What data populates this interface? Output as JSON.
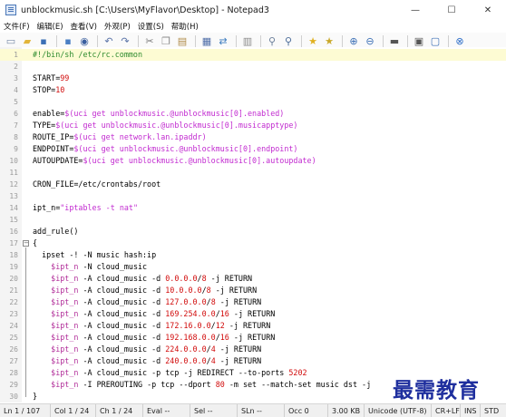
{
  "window": {
    "title": "unblockmusic.sh [C:\\Users\\MyFlavor\\Desktop] - Notepad3",
    "controls": {
      "minimize": "—",
      "maximize": "☐",
      "close": "✕"
    }
  },
  "menu": [
    "文件(F)",
    "编辑(E)",
    "查看(V)",
    "外观(P)",
    "设置(S)",
    "帮助(H)"
  ],
  "toolbar": [
    {
      "name": "new-file-icon",
      "glyph": "▭",
      "color": "#7a8ca8"
    },
    {
      "name": "open-folder-icon",
      "glyph": "▰",
      "color": "#e2b53a"
    },
    {
      "name": "save-icon",
      "glyph": "▪",
      "color": "#3b6fb5"
    },
    {
      "name": "sep"
    },
    {
      "name": "save-as-icon",
      "glyph": "▪",
      "color": "#4a7fc4"
    },
    {
      "name": "browse-icon",
      "glyph": "◉",
      "color": "#3a5f9e"
    },
    {
      "name": "sep"
    },
    {
      "name": "undo-icon",
      "glyph": "↶",
      "color": "#5a73a8"
    },
    {
      "name": "redo-icon",
      "glyph": "↷",
      "color": "#5a73a8"
    },
    {
      "name": "sep"
    },
    {
      "name": "cut-icon",
      "glyph": "✂",
      "color": "#7a7a7a"
    },
    {
      "name": "copy-icon",
      "glyph": "❐",
      "color": "#8a8a8a"
    },
    {
      "name": "paste-icon",
      "glyph": "▤",
      "color": "#b08c4a"
    },
    {
      "name": "sep"
    },
    {
      "name": "find-icon",
      "glyph": "▦",
      "color": "#4f6ea8"
    },
    {
      "name": "replace-icon",
      "glyph": "⇄",
      "color": "#3b7bbf"
    },
    {
      "name": "sep"
    },
    {
      "name": "word-wrap-icon",
      "glyph": "▥",
      "color": "#8a8a8a"
    },
    {
      "name": "sep"
    },
    {
      "name": "zoom-in-icon",
      "glyph": "⚲",
      "color": "#6b7f9a"
    },
    {
      "name": "zoom-search-icon",
      "glyph": "⚲",
      "color": "#4d6d9a"
    },
    {
      "name": "sep"
    },
    {
      "name": "favorite-icon",
      "glyph": "★",
      "color": "#e0b020"
    },
    {
      "name": "add-favorite-icon",
      "glyph": "★",
      "color": "#c9a82a"
    },
    {
      "name": "sep"
    },
    {
      "name": "zoom-in-lens-icon",
      "glyph": "⊕",
      "color": "#3b6fb5"
    },
    {
      "name": "zoom-out-lens-icon",
      "glyph": "⊖",
      "color": "#3b6fb5"
    },
    {
      "name": "sep"
    },
    {
      "name": "scheme-icon",
      "glyph": "▬",
      "color": "#555"
    },
    {
      "name": "sep"
    },
    {
      "name": "customize-icon",
      "glyph": "▣",
      "color": "#555"
    },
    {
      "name": "window-icon",
      "glyph": "▢",
      "color": "#3b6fb5"
    },
    {
      "name": "sep"
    },
    {
      "name": "exit-icon",
      "glyph": "⊗",
      "color": "#2f6fc8"
    }
  ],
  "editor": {
    "current_line": 1,
    "lines": [
      [
        [
          "#!/bin/sh /etc/rc.common",
          "cmt"
        ]
      ],
      [],
      [
        [
          "START=",
          "dflt"
        ],
        [
          "99",
          "num"
        ]
      ],
      [
        [
          "STOP=",
          "dflt"
        ],
        [
          "10",
          "num"
        ]
      ],
      [],
      [
        [
          "enable=",
          "dflt"
        ],
        [
          "$(uci get unblockmusic.@unblockmusic[0].enabled)",
          "str"
        ]
      ],
      [
        [
          "TYPE=",
          "dflt"
        ],
        [
          "$(uci get unblockmusic.@unblockmusic[0].musicapptype)",
          "str"
        ]
      ],
      [
        [
          "ROUTE_IP=",
          "dflt"
        ],
        [
          "$(uci get network.lan.ipaddr)",
          "str"
        ]
      ],
      [
        [
          "ENDPOINT=",
          "dflt"
        ],
        [
          "$(uci get unblockmusic.@unblockmusic[0].endpoint)",
          "str"
        ]
      ],
      [
        [
          "AUTOUPDATE=",
          "dflt"
        ],
        [
          "$(uci get unblockmusic.@unblockmusic[0].autoupdate)",
          "str"
        ]
      ],
      [],
      [
        [
          "CRON_FILE=/etc/crontabs/root",
          "dflt"
        ]
      ],
      [],
      [
        [
          "ipt_n=",
          "dflt"
        ],
        [
          "\"iptables -t nat\"",
          "str"
        ]
      ],
      [],
      [
        [
          "add_rule()",
          "dflt"
        ]
      ],
      [
        [
          "{",
          "dflt"
        ]
      ],
      [
        [
          "  ipset -! -N music hash:ip",
          "dflt"
        ]
      ],
      [
        [
          "    ",
          "dflt"
        ],
        [
          "$ipt_n",
          "var"
        ],
        [
          " -N cloud_music",
          "dflt"
        ]
      ],
      [
        [
          "    ",
          "dflt"
        ],
        [
          "$ipt_n",
          "var"
        ],
        [
          " -A cloud_music -d ",
          "dflt"
        ],
        [
          "0.0.0.0",
          "num"
        ],
        [
          "/",
          "dflt"
        ],
        [
          "8",
          "num"
        ],
        [
          " -j RETURN",
          "dflt"
        ]
      ],
      [
        [
          "    ",
          "dflt"
        ],
        [
          "$ipt_n",
          "var"
        ],
        [
          " -A cloud_music -d ",
          "dflt"
        ],
        [
          "10.0.0.0",
          "num"
        ],
        [
          "/",
          "dflt"
        ],
        [
          "8",
          "num"
        ],
        [
          " -j RETURN",
          "dflt"
        ]
      ],
      [
        [
          "    ",
          "dflt"
        ],
        [
          "$ipt_n",
          "var"
        ],
        [
          " -A cloud_music -d ",
          "dflt"
        ],
        [
          "127.0.0.0",
          "num"
        ],
        [
          "/",
          "dflt"
        ],
        [
          "8",
          "num"
        ],
        [
          " -j RETURN",
          "dflt"
        ]
      ],
      [
        [
          "    ",
          "dflt"
        ],
        [
          "$ipt_n",
          "var"
        ],
        [
          " -A cloud_music -d ",
          "dflt"
        ],
        [
          "169.254.0.0",
          "num"
        ],
        [
          "/",
          "dflt"
        ],
        [
          "16",
          "num"
        ],
        [
          " -j RETURN",
          "dflt"
        ]
      ],
      [
        [
          "    ",
          "dflt"
        ],
        [
          "$ipt_n",
          "var"
        ],
        [
          " -A cloud_music -d ",
          "dflt"
        ],
        [
          "172.16.0.0",
          "num"
        ],
        [
          "/",
          "dflt"
        ],
        [
          "12",
          "num"
        ],
        [
          " -j RETURN",
          "dflt"
        ]
      ],
      [
        [
          "    ",
          "dflt"
        ],
        [
          "$ipt_n",
          "var"
        ],
        [
          " -A cloud_music -d ",
          "dflt"
        ],
        [
          "192.168.0.0",
          "num"
        ],
        [
          "/",
          "dflt"
        ],
        [
          "16",
          "num"
        ],
        [
          " -j RETURN",
          "dflt"
        ]
      ],
      [
        [
          "    ",
          "dflt"
        ],
        [
          "$ipt_n",
          "var"
        ],
        [
          " -A cloud_music -d ",
          "dflt"
        ],
        [
          "224.0.0.0",
          "num"
        ],
        [
          "/",
          "dflt"
        ],
        [
          "4",
          "num"
        ],
        [
          " -j RETURN",
          "dflt"
        ]
      ],
      [
        [
          "    ",
          "dflt"
        ],
        [
          "$ipt_n",
          "var"
        ],
        [
          " -A cloud_music -d ",
          "dflt"
        ],
        [
          "240.0.0.0",
          "num"
        ],
        [
          "/",
          "dflt"
        ],
        [
          "4",
          "num"
        ],
        [
          " -j RETURN",
          "dflt"
        ]
      ],
      [
        [
          "    ",
          "dflt"
        ],
        [
          "$ipt_n",
          "var"
        ],
        [
          " -A cloud_music -p tcp -j REDIRECT --to-ports ",
          "dflt"
        ],
        [
          "5202",
          "num"
        ]
      ],
      [
        [
          "    ",
          "dflt"
        ],
        [
          "$ipt_n",
          "var"
        ],
        [
          " -I PREROUTING -p tcp --dport ",
          "dflt"
        ],
        [
          "80",
          "num"
        ],
        [
          " -m set --match-set music dst -j",
          "dflt"
        ]
      ],
      [
        [
          "}",
          "dflt"
        ]
      ]
    ]
  },
  "status": {
    "line": "Ln 1 / 107",
    "col": "Col 1 / 24",
    "ch": "Ch 1 / 24",
    "eval": "Eval --",
    "sel": "Sel --",
    "sln": "SLn --",
    "occ": "Occ 0",
    "size": "3.00 KB",
    "encoding": "Unicode (UTF-8)",
    "eol": "CR+LF",
    "ins": "INS",
    "std": "STD"
  },
  "watermark": "最需教育"
}
